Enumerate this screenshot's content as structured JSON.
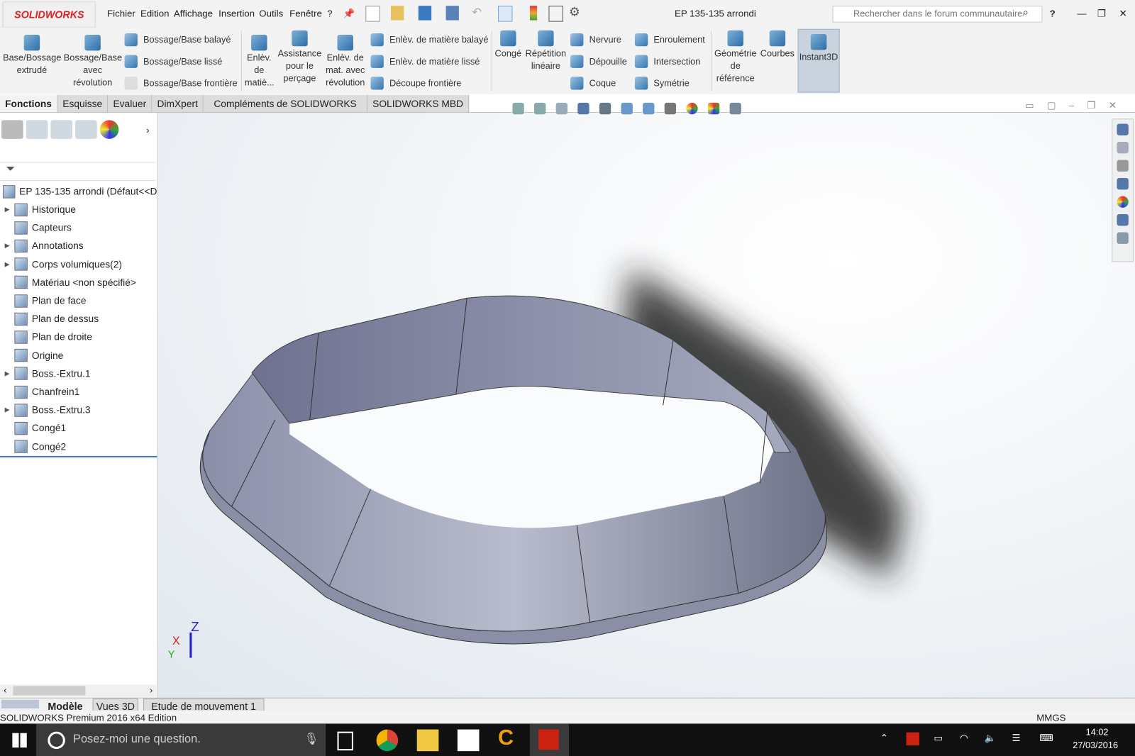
{
  "app": {
    "logo": "SOLIDWORKS",
    "title": "EP 135-135 arrondi"
  },
  "menu": [
    "Fichier",
    "Edition",
    "Affichage",
    "Insertion",
    "Outils",
    "Fenêtre",
    "?"
  ],
  "search": {
    "placeholder": "Rechercher dans le forum communautaire"
  },
  "ribbon": {
    "big": [
      "Base/Bossage extrudé",
      "Bossage/Base avec révolution",
      "Enlèv. de matiè...",
      "Assistance pour le perçage",
      "Enlèv. de mat. avec révolution",
      "Congé",
      "Répétition linéaire",
      "Géométrie de référence",
      "Courbes",
      "Instant3D"
    ],
    "col1": [
      "Bossage/Base balayé",
      "Bossage/Base lissé",
      "Bossage/Base frontière"
    ],
    "col2": [
      "Enlèv. de matière balayé",
      "Enlèv. de matière lissé",
      "Découpe frontière"
    ],
    "col3": [
      "Nervure",
      "Dépouille",
      "Coque"
    ],
    "col4": [
      "Enroulement",
      "Intersection",
      "Symétrie"
    ]
  },
  "tabs": [
    "Fonctions",
    "Esquisse",
    "Evaluer",
    "DimXpert",
    "Compléments de SOLIDWORKS",
    "SOLIDWORKS MBD"
  ],
  "tree": {
    "root": "EP 135-135 arrondi  (Défaut<<D",
    "items": [
      {
        "label": "Historique",
        "expand": true
      },
      {
        "label": "Capteurs",
        "expand": false
      },
      {
        "label": "Annotations",
        "expand": true
      },
      {
        "label": "Corps volumiques(2)",
        "expand": true
      },
      {
        "label": "Matériau <non spécifié>",
        "expand": false
      },
      {
        "label": "Plan de face",
        "expand": false
      },
      {
        "label": "Plan de dessus",
        "expand": false
      },
      {
        "label": "Plan de droite",
        "expand": false
      },
      {
        "label": "Origine",
        "expand": false
      },
      {
        "label": "Boss.-Extru.1",
        "expand": true
      },
      {
        "label": "Chanfrein1",
        "expand": false
      },
      {
        "label": "Boss.-Extru.3",
        "expand": true
      },
      {
        "label": "Congé1",
        "expand": false
      },
      {
        "label": "Congé2",
        "expand": false
      }
    ]
  },
  "triad": {
    "x": "X",
    "y": "Y",
    "z": "Z"
  },
  "bottom_tabs": [
    "Modèle",
    "Vues 3D",
    "Etude de mouvement 1"
  ],
  "status": {
    "left": "SOLIDWORKS Premium 2016 x64 Edition",
    "units": "MMGS"
  },
  "taskbar": {
    "search": "Posez-moi une question.",
    "time": "14:02",
    "date": "27/03/2016"
  }
}
